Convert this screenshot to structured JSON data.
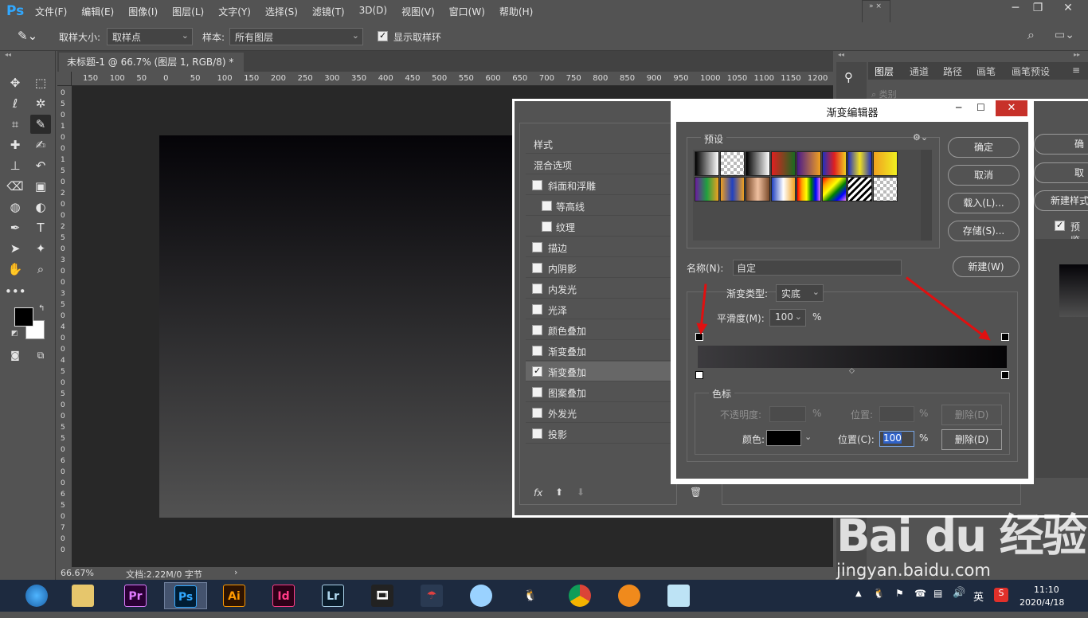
{
  "app": {
    "logo": "Ps"
  },
  "menu": [
    "文件(F)",
    "编辑(E)",
    "图像(I)",
    "图层(L)",
    "文字(Y)",
    "选择(S)",
    "滤镜(T)",
    "3D(D)",
    "视图(V)",
    "窗口(W)",
    "帮助(H)"
  ],
  "options": {
    "sample_size_label": "取样大小:",
    "sample_size_value": "取样点",
    "sample_label": "样本:",
    "sample_value": "所有图层",
    "show_ring_label": "显示取样环"
  },
  "document": {
    "tab_title": "未标题-1 @ 66.7% (图层 1, RGB/8) *",
    "zoom": "66.67%",
    "doc_info": "文档:2.22M/0 字节"
  },
  "ruler_h": [
    "150",
    "100",
    "50",
    "0",
    "50",
    "100",
    "150",
    "200",
    "250",
    "300",
    "350",
    "400",
    "450",
    "500",
    "550",
    "600",
    "650",
    "700",
    "750",
    "800",
    "850",
    "900",
    "950",
    "1000",
    "1050",
    "1100",
    "1150",
    "1200"
  ],
  "ruler_v": [
    "0",
    "5",
    "0",
    "1",
    "0",
    "0",
    "1",
    "5",
    "0",
    "2",
    "0",
    "0",
    "2",
    "5",
    "0",
    "3",
    "0",
    "0",
    "3",
    "5",
    "0",
    "4",
    "0",
    "0",
    "4",
    "5",
    "0",
    "5",
    "0",
    "0",
    "5",
    "5",
    "0",
    "6",
    "0",
    "0",
    "6",
    "5",
    "0",
    "7",
    "0",
    "0"
  ],
  "right_panel": {
    "tabs": [
      "图层",
      "通道",
      "路径",
      "画笔",
      "画笔预设"
    ],
    "kind_label": "类别"
  },
  "layer_style": {
    "header": "样式",
    "blend_options": "混合选项",
    "items": [
      {
        "label": "斜面和浮雕",
        "checked": false,
        "indent": false
      },
      {
        "label": "等高线",
        "checked": false,
        "indent": true
      },
      {
        "label": "纹理",
        "checked": false,
        "indent": true
      },
      {
        "label": "描边",
        "checked": false,
        "indent": false
      },
      {
        "label": "内阴影",
        "checked": false,
        "indent": false
      },
      {
        "label": "内发光",
        "checked": false,
        "indent": false
      },
      {
        "label": "光泽",
        "checked": false,
        "indent": false
      },
      {
        "label": "颜色叠加",
        "checked": false,
        "indent": false
      },
      {
        "label": "渐变叠加",
        "checked": false,
        "indent": false
      },
      {
        "label": "渐变叠加",
        "checked": true,
        "indent": false
      },
      {
        "label": "图案叠加",
        "checked": false,
        "indent": false
      },
      {
        "label": "外发光",
        "checked": false,
        "indent": false
      },
      {
        "label": "投影",
        "checked": false,
        "indent": false
      }
    ],
    "fx": "fx",
    "right_buttons": [
      "确",
      "取",
      "新建样式"
    ],
    "preview_label": "预览"
  },
  "gradient_editor": {
    "title": "渐变编辑器",
    "presets_label": "预设",
    "buttons": {
      "ok": "确定",
      "cancel": "取消",
      "load": "载入(L)...",
      "save": "存储(S)...",
      "new": "新建(W)"
    },
    "name_label": "名称(N):",
    "name_value": "自定",
    "type_label": "渐变类型:",
    "type_value": "实底",
    "smooth_label": "平滑度(M):",
    "smooth_value": "100",
    "percent": "%",
    "stops_label": "色标",
    "opacity_label": "不透明度:",
    "location_label": "位置:",
    "delete_label": "删除(D)",
    "color_label": "颜色:",
    "location_c_label": "位置(C):",
    "location_c_value": "100",
    "gradient_start": "#3c3b3e",
    "gradient_end": "#050406"
  },
  "taskbar": {
    "apps": [
      "Pr",
      "Ps",
      "Ai",
      "Id",
      "Lr"
    ],
    "time": "11:10",
    "date": "2020/4/18",
    "ime": "英"
  },
  "watermark": {
    "brand": "Bai du 经验",
    "url": "jingyan.baidu.com"
  }
}
